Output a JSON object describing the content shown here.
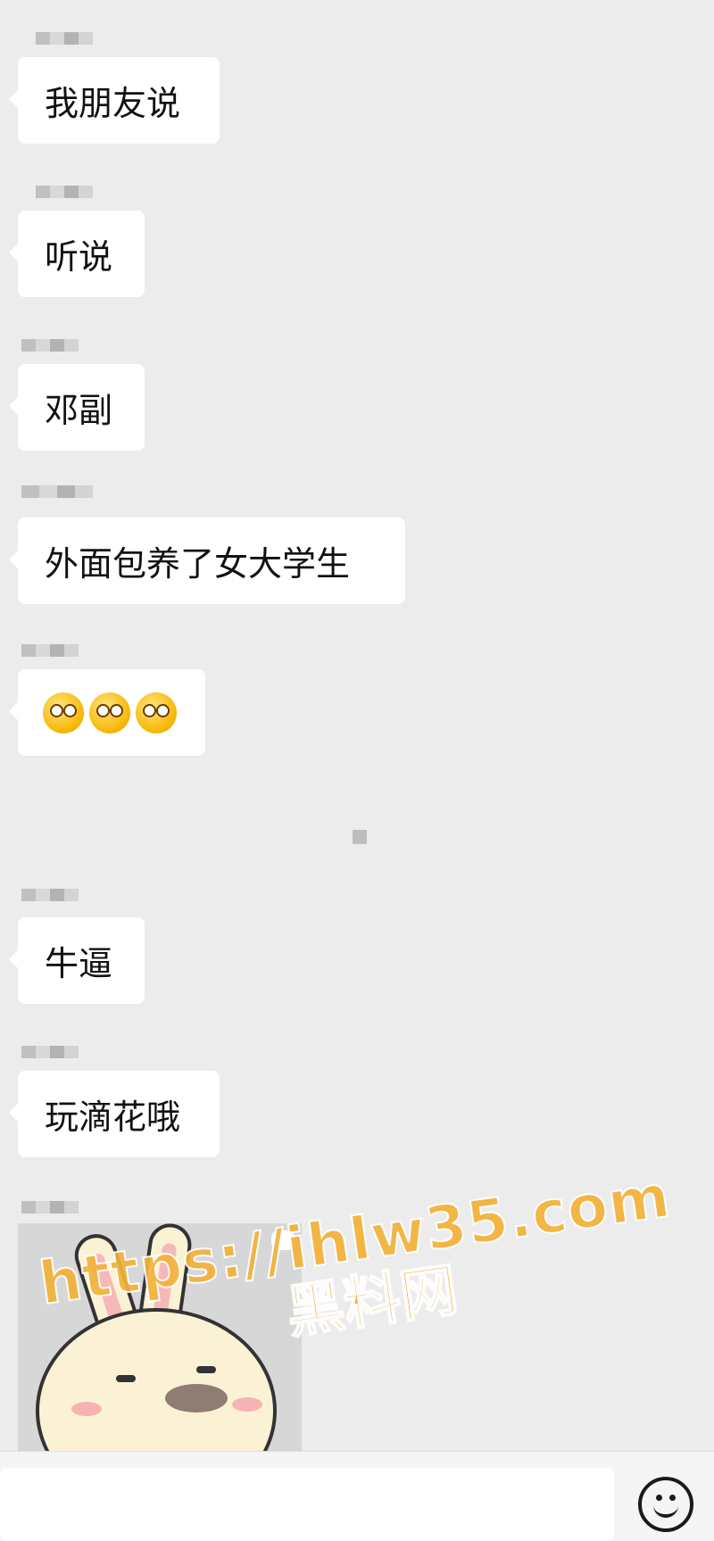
{
  "messages": [
    {
      "text": "我朋友说"
    },
    {
      "text": "听说"
    },
    {
      "text": "邓副"
    },
    {
      "text": "外面包养了女大学生"
    },
    {
      "emoji_name": "crazy-face-icon",
      "emoji_count": 3
    },
    {
      "text": "牛逼"
    },
    {
      "text": "玩滴花哦"
    },
    {
      "sticker": "rabbit-sticker"
    }
  ],
  "watermark": {
    "url": "https://ihlw35.com",
    "site": "黑料网"
  },
  "composer": {
    "input_value": "",
    "emoji_button_icon": "smile-icon"
  },
  "colors": {
    "background": "#ececec",
    "bubble": "#ffffff",
    "watermark": "#f3b23a"
  }
}
